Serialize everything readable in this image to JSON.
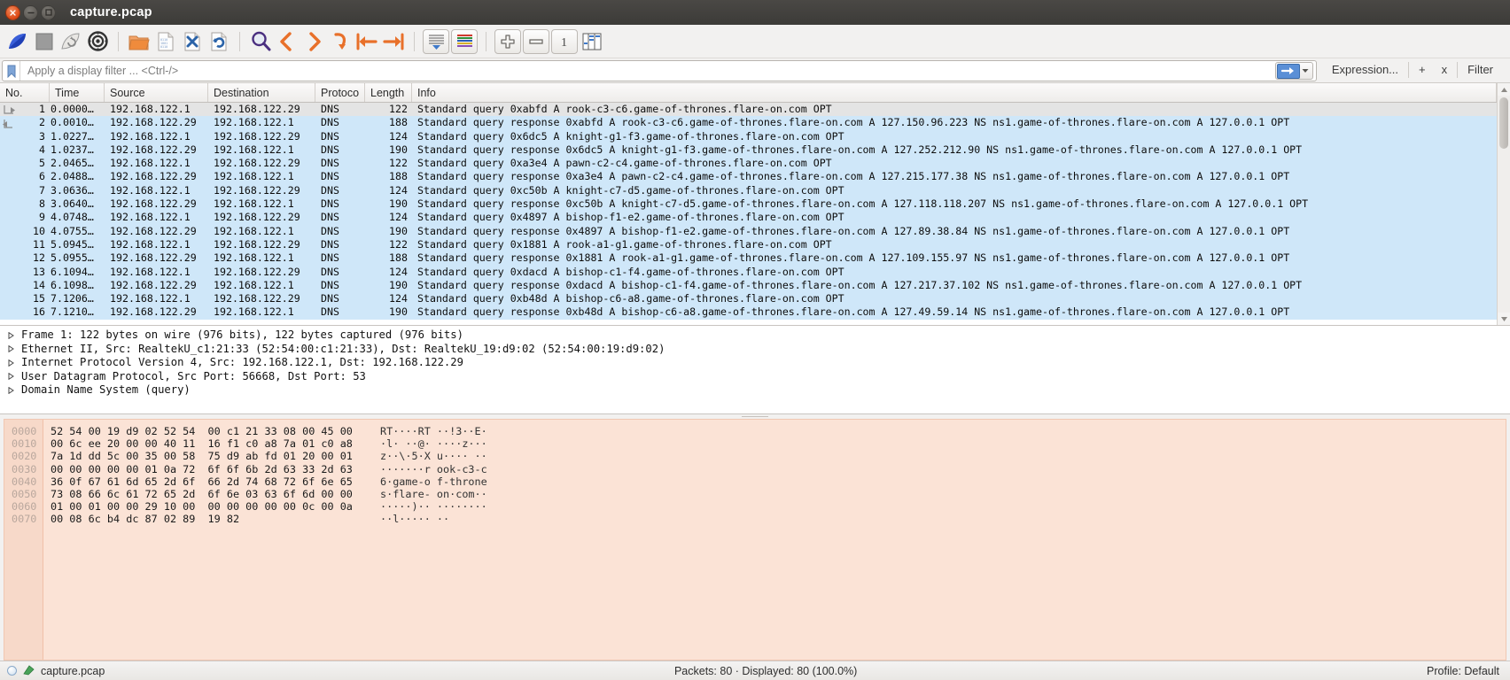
{
  "window": {
    "title": "capture.pcap",
    "buttons": {
      "close": "close",
      "minimize": "minimize",
      "maximize": "maximize"
    }
  },
  "toolbar": {
    "items": [
      {
        "name": "start-capture",
        "icon": "shark-fin"
      },
      {
        "name": "stop-capture",
        "icon": "stop-square"
      },
      {
        "name": "restart-capture",
        "icon": "restart-fin"
      },
      {
        "name": "capture-options",
        "icon": "gear"
      },
      {
        "name": "open-file",
        "icon": "open-folder"
      },
      {
        "name": "save-file",
        "icon": "save-document"
      },
      {
        "name": "close-file",
        "icon": "close-document"
      },
      {
        "name": "reload-file",
        "icon": "reload-document"
      },
      {
        "name": "find-packet",
        "icon": "magnifier"
      },
      {
        "name": "go-back",
        "icon": "chevron-left"
      },
      {
        "name": "go-forward",
        "icon": "chevron-right"
      },
      {
        "name": "go-to-packet",
        "icon": "arrow-down-curve"
      },
      {
        "name": "go-to-first-packet",
        "icon": "arrow-to-start"
      },
      {
        "name": "go-to-last-packet",
        "icon": "arrow-to-end"
      },
      {
        "name": "auto-scroll",
        "icon": "autoscroll-lines"
      },
      {
        "name": "colorize-packets",
        "icon": "color-lines"
      },
      {
        "name": "zoom-in",
        "icon": "plus-box"
      },
      {
        "name": "zoom-out",
        "icon": "minus-box"
      },
      {
        "name": "zoom-reset",
        "icon": "one-box"
      },
      {
        "name": "resize-columns",
        "icon": "columns-resize"
      }
    ]
  },
  "filterbar": {
    "placeholder": "Apply a display filter ... <Ctrl-/>",
    "value": "",
    "bookmark_icon": "bookmark-icon",
    "apply_icon": "arrow-right-icon",
    "dropdown_icon": "chevron-down-icon",
    "expression_label": "Expression...",
    "plus_label": "+",
    "x_label": "x",
    "filter_label": "Filter"
  },
  "packet_list": {
    "columns": [
      "No.",
      "Time",
      "Source",
      "Destination",
      "Protoco",
      "Length",
      "Info"
    ],
    "selected_row_index": 0,
    "rows": [
      {
        "no": "1",
        "time": "0.0000…",
        "source": "192.168.122.1",
        "destination": "192.168.122.29",
        "protocol": "DNS",
        "length": "122",
        "info": "Standard query 0xabfd A rook-c3-c6.game-of-thrones.flare-on.com OPT"
      },
      {
        "no": "2",
        "time": "0.0010…",
        "source": "192.168.122.29",
        "destination": "192.168.122.1",
        "protocol": "DNS",
        "length": "188",
        "info": "Standard query response 0xabfd A rook-c3-c6.game-of-thrones.flare-on.com A 127.150.96.223 NS ns1.game-of-thrones.flare-on.com A 127.0.0.1 OPT"
      },
      {
        "no": "3",
        "time": "1.0227…",
        "source": "192.168.122.1",
        "destination": "192.168.122.29",
        "protocol": "DNS",
        "length": "124",
        "info": "Standard query 0x6dc5 A knight-g1-f3.game-of-thrones.flare-on.com OPT"
      },
      {
        "no": "4",
        "time": "1.0237…",
        "source": "192.168.122.29",
        "destination": "192.168.122.1",
        "protocol": "DNS",
        "length": "190",
        "info": "Standard query response 0x6dc5 A knight-g1-f3.game-of-thrones.flare-on.com A 127.252.212.90 NS ns1.game-of-thrones.flare-on.com A 127.0.0.1 OPT"
      },
      {
        "no": "5",
        "time": "2.0465…",
        "source": "192.168.122.1",
        "destination": "192.168.122.29",
        "protocol": "DNS",
        "length": "122",
        "info": "Standard query 0xa3e4 A pawn-c2-c4.game-of-thrones.flare-on.com OPT"
      },
      {
        "no": "6",
        "time": "2.0488…",
        "source": "192.168.122.29",
        "destination": "192.168.122.1",
        "protocol": "DNS",
        "length": "188",
        "info": "Standard query response 0xa3e4 A pawn-c2-c4.game-of-thrones.flare-on.com A 127.215.177.38 NS ns1.game-of-thrones.flare-on.com A 127.0.0.1 OPT"
      },
      {
        "no": "7",
        "time": "3.0636…",
        "source": "192.168.122.1",
        "destination": "192.168.122.29",
        "protocol": "DNS",
        "length": "124",
        "info": "Standard query 0xc50b A knight-c7-d5.game-of-thrones.flare-on.com OPT"
      },
      {
        "no": "8",
        "time": "3.0640…",
        "source": "192.168.122.29",
        "destination": "192.168.122.1",
        "protocol": "DNS",
        "length": "190",
        "info": "Standard query response 0xc50b A knight-c7-d5.game-of-thrones.flare-on.com A 127.118.118.207 NS ns1.game-of-thrones.flare-on.com A 127.0.0.1 OPT"
      },
      {
        "no": "9",
        "time": "4.0748…",
        "source": "192.168.122.1",
        "destination": "192.168.122.29",
        "protocol": "DNS",
        "length": "124",
        "info": "Standard query 0x4897 A bishop-f1-e2.game-of-thrones.flare-on.com OPT"
      },
      {
        "no": "10",
        "time": "4.0755…",
        "source": "192.168.122.29",
        "destination": "192.168.122.1",
        "protocol": "DNS",
        "length": "190",
        "info": "Standard query response 0x4897 A bishop-f1-e2.game-of-thrones.flare-on.com A 127.89.38.84 NS ns1.game-of-thrones.flare-on.com A 127.0.0.1 OPT"
      },
      {
        "no": "11",
        "time": "5.0945…",
        "source": "192.168.122.1",
        "destination": "192.168.122.29",
        "protocol": "DNS",
        "length": "122",
        "info": "Standard query 0x1881 A rook-a1-g1.game-of-thrones.flare-on.com OPT"
      },
      {
        "no": "12",
        "time": "5.0955…",
        "source": "192.168.122.29",
        "destination": "192.168.122.1",
        "protocol": "DNS",
        "length": "188",
        "info": "Standard query response 0x1881 A rook-a1-g1.game-of-thrones.flare-on.com A 127.109.155.97 NS ns1.game-of-thrones.flare-on.com A 127.0.0.1 OPT"
      },
      {
        "no": "13",
        "time": "6.1094…",
        "source": "192.168.122.1",
        "destination": "192.168.122.29",
        "protocol": "DNS",
        "length": "124",
        "info": "Standard query 0xdacd A bishop-c1-f4.game-of-thrones.flare-on.com OPT"
      },
      {
        "no": "14",
        "time": "6.1098…",
        "source": "192.168.122.29",
        "destination": "192.168.122.1",
        "protocol": "DNS",
        "length": "190",
        "info": "Standard query response 0xdacd A bishop-c1-f4.game-of-thrones.flare-on.com A 127.217.37.102 NS ns1.game-of-thrones.flare-on.com A 127.0.0.1 OPT"
      },
      {
        "no": "15",
        "time": "7.1206…",
        "source": "192.168.122.1",
        "destination": "192.168.122.29",
        "protocol": "DNS",
        "length": "124",
        "info": "Standard query 0xb48d A bishop-c6-a8.game-of-thrones.flare-on.com OPT"
      },
      {
        "no": "16",
        "time": "7.1210…",
        "source": "192.168.122.29",
        "destination": "192.168.122.1",
        "protocol": "DNS",
        "length": "190",
        "info": "Standard query response 0xb48d A bishop-c6-a8.game-of-thrones.flare-on.com A 127.49.59.14 NS ns1.game-of-thrones.flare-on.com A 127.0.0.1 OPT"
      }
    ]
  },
  "packet_detail": {
    "lines": [
      "Frame 1: 122 bytes on wire (976 bits), 122 bytes captured (976 bits)",
      "Ethernet II, Src: RealtekU_c1:21:33 (52:54:00:c1:21:33), Dst: RealtekU_19:d9:02 (52:54:00:19:d9:02)",
      "Internet Protocol Version 4, Src: 192.168.122.1, Dst: 192.168.122.29",
      "User Datagram Protocol, Src Port: 56668, Dst Port: 53",
      "Domain Name System (query)"
    ]
  },
  "hex_dump": {
    "lines": [
      {
        "offset": "0000",
        "left": "52 54 00 19 d9 02 52 54",
        "right": "00 c1 21 33 08 00 45 00",
        "ascii_left": "RT····RT",
        "ascii_right": "··!3··E·"
      },
      {
        "offset": "0010",
        "left": "00 6c ee 20 00 00 40 11",
        "right": "16 f1 c0 a8 7a 01 c0 a8",
        "ascii_left": "·l· ··@·",
        "ascii_right": "····z···"
      },
      {
        "offset": "0020",
        "left": "7a 1d dd 5c 00 35 00 58",
        "right": "75 d9 ab fd 01 20 00 01",
        "ascii_left": "z··\\·5·X",
        "ascii_right": "u···· ··"
      },
      {
        "offset": "0030",
        "left": "00 00 00 00 00 01 0a 72",
        "right": "6f 6f 6b 2d 63 33 2d 63",
        "ascii_left": "·······r",
        "ascii_right": "ook-c3-c"
      },
      {
        "offset": "0040",
        "left": "36 0f 67 61 6d 65 2d 6f",
        "right": "66 2d 74 68 72 6f 6e 65",
        "ascii_left": "6·game-o",
        "ascii_right": "f-throne"
      },
      {
        "offset": "0050",
        "left": "73 08 66 6c 61 72 65 2d",
        "right": "6f 6e 03 63 6f 6d 00 00",
        "ascii_left": "s·flare-",
        "ascii_right": "on·com··"
      },
      {
        "offset": "0060",
        "left": "01 00 01 00 00 29 10 00",
        "right": "00 00 00 00 00 0c 00 0a",
        "ascii_left": "·····)··",
        "ascii_right": "········"
      },
      {
        "offset": "0070",
        "left": "00 08 6c b4 dc 87 02 89",
        "right": "19 82",
        "ascii_left": "··l·····",
        "ascii_right": "··"
      }
    ]
  },
  "statusbar": {
    "file_label": "capture.pcap",
    "packets_label": "Packets: 80 · Displayed: 80 (100.0%)",
    "profile_label": "Profile: Default",
    "expert_icon": "expert-info-icon",
    "capture-file-icon": "capture-file-icon"
  },
  "colors": {
    "row_dns": "#cfe7f9",
    "row_selected": "#e4e4e4",
    "hex_bg": "#fbe3d6",
    "titlebar": "#3c3b38",
    "accent": "#dd4814"
  }
}
